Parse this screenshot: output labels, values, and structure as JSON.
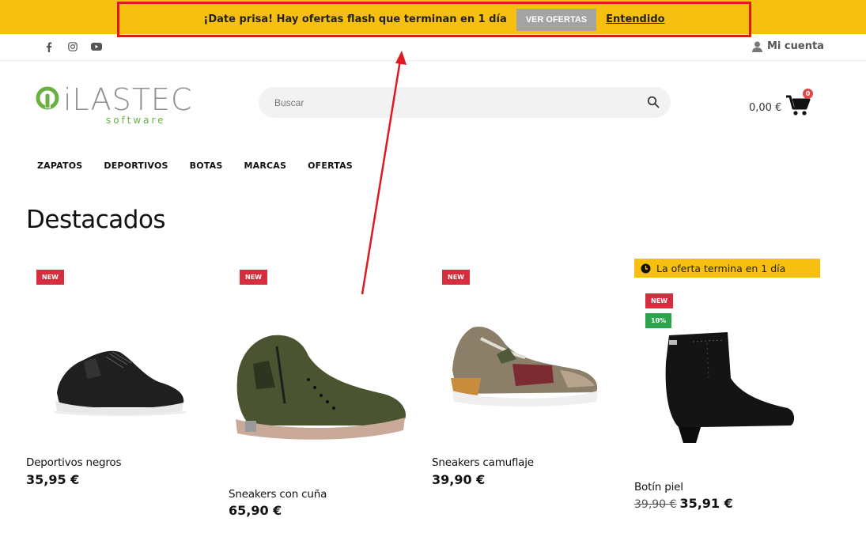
{
  "promo": {
    "message": "¡Date prisa! Hay ofertas flash que terminan en 1 día",
    "cta_label": "VER OFERTAS",
    "dismiss_label": "Entendido"
  },
  "topbar": {
    "social": [
      "facebook-icon",
      "instagram-icon",
      "youtube-icon"
    ],
    "account_label": "Mi cuenta"
  },
  "brand": {
    "name": "iLASTEC",
    "tagline": "software"
  },
  "search": {
    "placeholder": "Buscar"
  },
  "cart": {
    "total": "0,00 €",
    "count": "0"
  },
  "nav": {
    "items": [
      "ZAPATOS",
      "DEPORTIVOS",
      "BOTAS",
      "MARCAS",
      "OFERTAS"
    ]
  },
  "section": {
    "title": "Destacados"
  },
  "products": [
    {
      "badge": "NEW",
      "name": "Deportivos negros",
      "price": "35,95 €"
    },
    {
      "badge": "NEW",
      "name": "Sneakers con cuña",
      "price": "65,90 €"
    },
    {
      "badge": "NEW",
      "name": "Sneakers camuflaje",
      "price": "39,90 €"
    },
    {
      "badge": "NEW",
      "discount": "10%",
      "name": "Botín piel",
      "old_price": "39,90 €",
      "price": "35,91 €",
      "offer_note": "La oferta termina en 1 día"
    }
  ],
  "colors": {
    "promo_bg": "#f7c010",
    "annotation": "#e0191f",
    "badge_new": "#d72e3f",
    "badge_discount": "#2da44e",
    "cart_badge": "#e34848"
  }
}
